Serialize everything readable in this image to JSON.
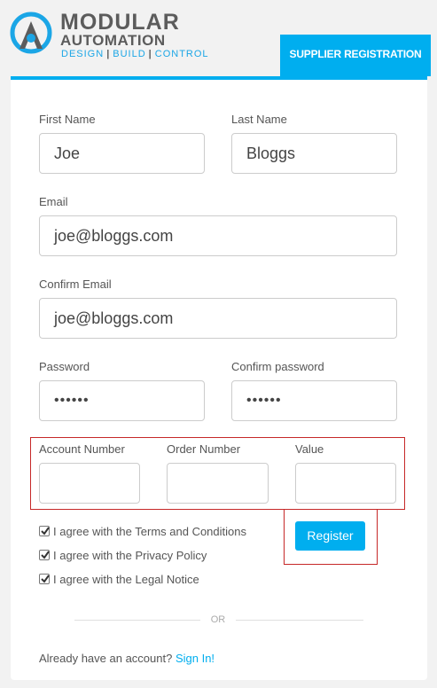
{
  "brand": {
    "line1": "MODULAR",
    "line2": "AUTOMATION",
    "tagline_parts": [
      "DESIGN",
      "BUILD",
      "CONTROL"
    ],
    "separator": "|",
    "accent_color": "#00aeef",
    "logo_icon": "logo-a-ring-icon"
  },
  "tab": {
    "label": "SUPPLIER REGISTRATION"
  },
  "form": {
    "first_name": {
      "label": "First Name",
      "value": "Joe"
    },
    "last_name": {
      "label": "Last Name",
      "value": "Bloggs"
    },
    "email": {
      "label": "Email",
      "value": "joe@bloggs.com"
    },
    "confirm_email": {
      "label": "Confirm Email",
      "value": "joe@bloggs.com"
    },
    "password": {
      "label": "Password",
      "value": "••••••"
    },
    "confirm_password": {
      "label": "Confirm password",
      "value": "••••••"
    },
    "account_number": {
      "label": "Account Number",
      "value": ""
    },
    "order_number": {
      "label": "Order Number",
      "value": ""
    },
    "value_field": {
      "label": "Value",
      "value": ""
    }
  },
  "agreements": [
    {
      "label": "I agree with the Terms and Conditions",
      "checked": true
    },
    {
      "label": "I agree with the Privacy Policy",
      "checked": true
    },
    {
      "label": "I agree with the Legal Notice",
      "checked": true
    }
  ],
  "register_button": {
    "label": "Register"
  },
  "divider": {
    "label": "OR"
  },
  "footer": {
    "text": "Already have an account?",
    "link": "Sign In!"
  },
  "highlight_color": "#c62828"
}
